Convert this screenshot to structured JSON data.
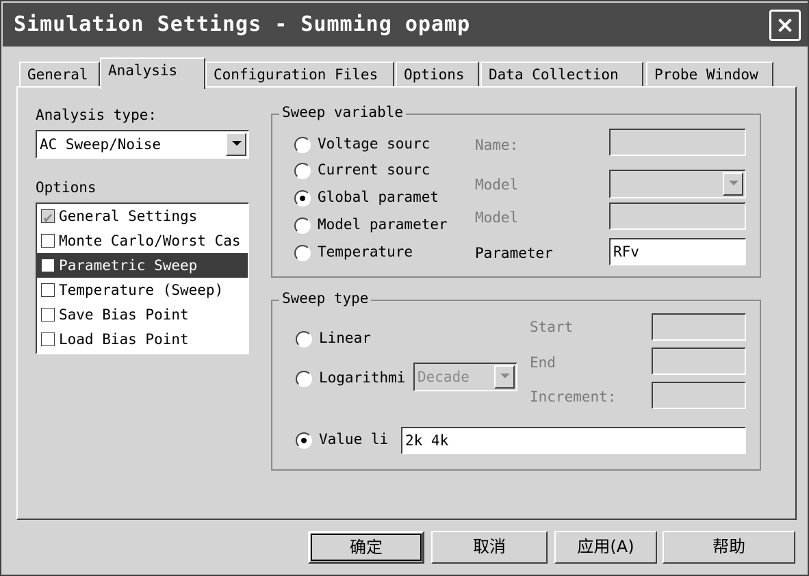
{
  "window": {
    "title": "Simulation Settings - Summing opamp"
  },
  "tabs": [
    "General",
    "Analysis",
    "Configuration Files",
    "Options",
    "Data Collection",
    "Probe Window"
  ],
  "left": {
    "analysis_type_label": "Analysis type:",
    "analysis_type_value": "AC Sweep/Noise",
    "options_label": "Options",
    "options": [
      {
        "label": "General Settings",
        "checked": true
      },
      {
        "label": "Monte Carlo/Worst Cas",
        "checked": false
      },
      {
        "label": "Parametric Sweep",
        "checked": true
      },
      {
        "label": "Temperature (Sweep)",
        "checked": false
      },
      {
        "label": "Save Bias Point",
        "checked": false
      },
      {
        "label": "Load Bias Point",
        "checked": false
      }
    ]
  },
  "sweep_variable": {
    "title": "Sweep variable",
    "options": [
      "Voltage sourc",
      "Current sourc",
      "Global paramet",
      "Model parameter",
      "Temperature"
    ],
    "selected": "Global paramet",
    "name_label": "Name:",
    "model_type_label": "Model",
    "model_name_label": "Model",
    "parameter_label": "Parameter",
    "parameter_value": "RFv"
  },
  "sweep_type": {
    "title": "Sweep type",
    "linear": "Linear",
    "logarithmic": "Logarithmi",
    "log_scale": "Decade",
    "start_label": "Start",
    "end_label": "End",
    "increment_label": "Increment:",
    "value_list": "Value li",
    "value_list_value": "2k 4k",
    "selected": "Value li"
  },
  "buttons": {
    "ok": "确定",
    "cancel": "取消",
    "apply": "应用(A)",
    "help": "帮助"
  },
  "icons": {
    "close": "close-icon",
    "dropdown": "chevron-down-icon",
    "check": "check-icon"
  }
}
